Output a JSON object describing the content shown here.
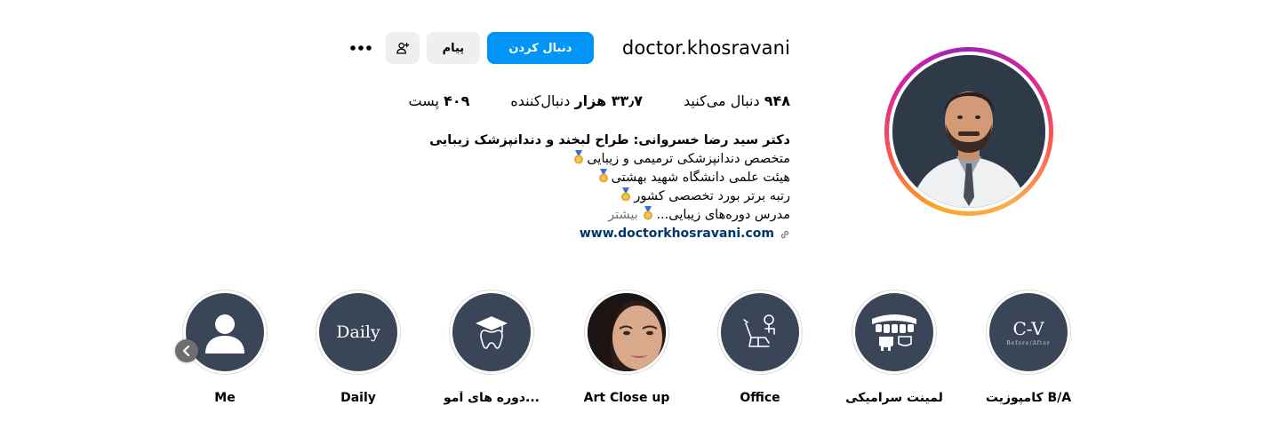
{
  "profile": {
    "username": "doctor.khosravani",
    "avatar_alt": "profile-photo"
  },
  "actions": {
    "follow_label": "دنبال کردن",
    "message_label": "پیام",
    "suggest_icon": "person-add-icon",
    "more_icon": "more-horizontal-icon"
  },
  "stats": {
    "posts_value": "۴۰۹",
    "posts_label": "پست",
    "followers_value": "۳۳٫۷ هزار",
    "followers_label": "دنبال‌کننده",
    "following_value": "۹۴۸",
    "following_label": "دنبال می‌کنید"
  },
  "bio": {
    "name": "دکتر سید رضا خسروانی: طراح لبخند و دندانپزشک زیبایی",
    "line1": "متخصص دندانپزشکی ترمیمی و زیبایی",
    "line2": "هیئت علمی دانشگاه شهید بهشتی",
    "line3": "رتبه برتر بورد تخصصی کشور",
    "line4": "مدرس دوره‌های زیبایی...",
    "more": "بیشتر",
    "link": "www.doctorkhosravani.com"
  },
  "highlights": [
    {
      "label": "کامپوزیت B/A",
      "cover": "C-V",
      "cover_sub": "Before/After"
    },
    {
      "label": "لمینت سرامیکی",
      "cover_icon": "veneer-teeth-icon"
    },
    {
      "label": "Office",
      "cover_icon": "dental-chair-icon"
    },
    {
      "label": "Art Close up",
      "cover_icon": "face-photo"
    },
    {
      "label": "دوره های آمو...",
      "cover_icon": "graduation-tooth-icon"
    },
    {
      "label": "Daily",
      "cover": "Daily"
    },
    {
      "label": "Me",
      "cover_icon": "person-silhouette-icon"
    }
  ],
  "colors": {
    "accent": "#0095f6",
    "secondary_button": "#efefef",
    "link": "#00376b",
    "highlight_bg": "#3a4657"
  }
}
